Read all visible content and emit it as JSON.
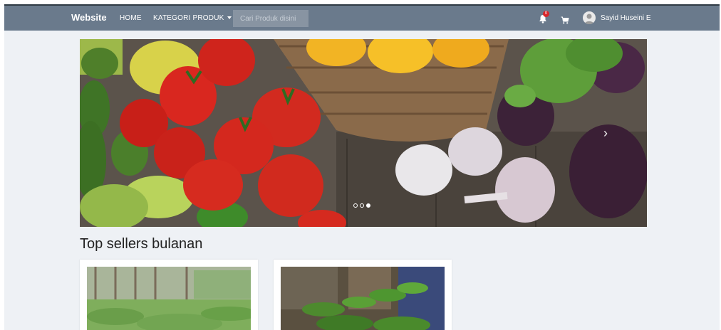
{
  "navbar": {
    "brand": "Website",
    "home_label": "HOME",
    "category_label": "KATEGORI PRODUK",
    "search_placeholder": "Cari Produk disini",
    "notification_count": "0",
    "user_name": "Sayid Huseini E",
    "notification_icon": "bell-icon",
    "cart_icon": "cart-icon"
  },
  "carousel": {
    "slide_count": 3,
    "active_slide": 3,
    "next_icon": "chevron-right-icon"
  },
  "main": {
    "section_title": "Top sellers bulanan"
  },
  "colors": {
    "navbar": "#6a7a8c",
    "page_background": "#eef1f5",
    "badge": "#d9262b"
  }
}
